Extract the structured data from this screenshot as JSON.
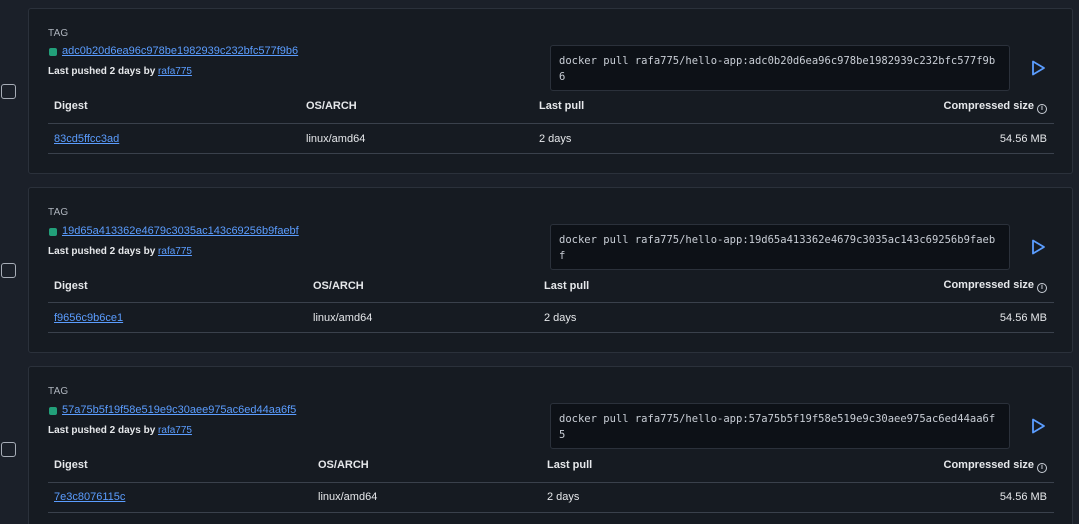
{
  "tags": [
    {
      "tag_label": "TAG",
      "tag_name": "adc0b20d6ea96c978be1982939c232bfc577f9b6",
      "pushed_prefix": "Last pushed 2 days by",
      "pushed_by": "rafa775",
      "pull_command": "docker pull rafa775/hello-app:adc0b20d6ea96c978be1982939c232bfc577f9b6",
      "headers": {
        "digest": "Digest",
        "os_arch": "OS/ARCH",
        "last_pull": "Last pull",
        "size": "Compressed size"
      },
      "row": {
        "digest": "83cd5ffcc3ad",
        "os_arch": "linux/amd64",
        "last_pull": "2 days",
        "size": "54.56 MB"
      }
    },
    {
      "tag_label": "TAG",
      "tag_name": "19d65a413362e4679c3035ac143c69256b9faebf",
      "pushed_prefix": "Last pushed 2 days by",
      "pushed_by": "rafa775",
      "pull_command": "docker pull rafa775/hello-app:19d65a413362e4679c3035ac143c69256b9faebf",
      "headers": {
        "digest": "Digest",
        "os_arch": "OS/ARCH",
        "last_pull": "Last pull",
        "size": "Compressed size"
      },
      "row": {
        "digest": "f9656c9b6ce1",
        "os_arch": "linux/amd64",
        "last_pull": "2 days",
        "size": "54.56 MB"
      }
    },
    {
      "tag_label": "TAG",
      "tag_name": "57a75b5f19f58e519e9c30aee975ac6ed44aa6f5",
      "pushed_prefix": "Last pushed 2 days by",
      "pushed_by": "rafa775",
      "pull_command": "docker pull rafa775/hello-app:57a75b5f19f58e519e9c30aee975ac6ed44aa6f5",
      "headers": {
        "digest": "Digest",
        "os_arch": "OS/ARCH",
        "last_pull": "Last pull",
        "size": "Compressed size"
      },
      "row": {
        "digest": "7e3c8076115c",
        "os_arch": "linux/amd64",
        "last_pull": "2 days",
        "size": "54.56 MB"
      }
    }
  ],
  "icons": {
    "run": "play-icon",
    "info": "info-icon",
    "status": "status-dot"
  },
  "colors": {
    "link": "#5b9dff",
    "status_ok": "#22a07a",
    "card_bg": "#161b22",
    "page_bg": "#1b2029"
  }
}
